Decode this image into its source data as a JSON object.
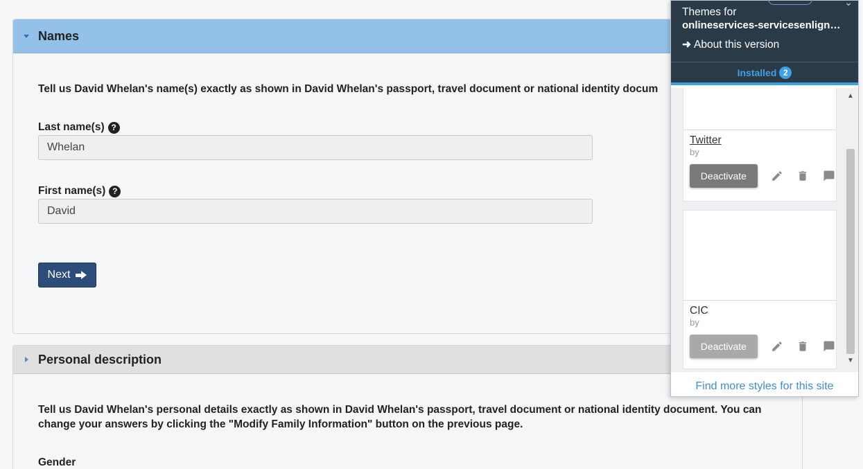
{
  "names_panel": {
    "title": "Names",
    "instructions": "Tell us David Whelan's name(s) exactly as shown in David Whelan's passport, travel document or national identity docum",
    "last_name": {
      "label": "Last name(s)",
      "value": "Whelan"
    },
    "first_name": {
      "label": "First name(s)",
      "value": "David"
    },
    "next_label": "Next",
    "help_glyph": "?"
  },
  "personal_panel": {
    "title": "Personal description",
    "instructions": "Tell us David Whelan's personal details exactly as shown in David Whelan's passport, travel document or national identity document. You can change your answers by clicking the \"Modify Family Information\" button on the previous page.",
    "gender_label": "Gender"
  },
  "popup": {
    "themes_for": "Themes for",
    "site_name": "onlineservices-servicesenlign…",
    "about_arrow": "➜",
    "about_version": "About this version",
    "installed_label": "Installed",
    "installed_count": "2",
    "styles": [
      {
        "name": "Twitter",
        "by": "by",
        "deactivate": "Deactivate"
      },
      {
        "name": "CIC",
        "by": "by",
        "deactivate": "Deactivate"
      }
    ],
    "find_more": "Find more styles for this site"
  },
  "icons": [
    "chevron-down-icon",
    "chevron-right-icon",
    "help-icon",
    "arrow-right-icon",
    "edit-icon",
    "delete-icon",
    "comment-icon",
    "scroll-up-icon",
    "scroll-down-icon"
  ],
  "colors": {
    "names_header_bg": "#94c1e9",
    "next_button_bg": "#2c4d7a",
    "popup_header_bg": "#2b3a47",
    "installed_accent": "#3ca1e6",
    "link_color": "#3c8fd0"
  }
}
